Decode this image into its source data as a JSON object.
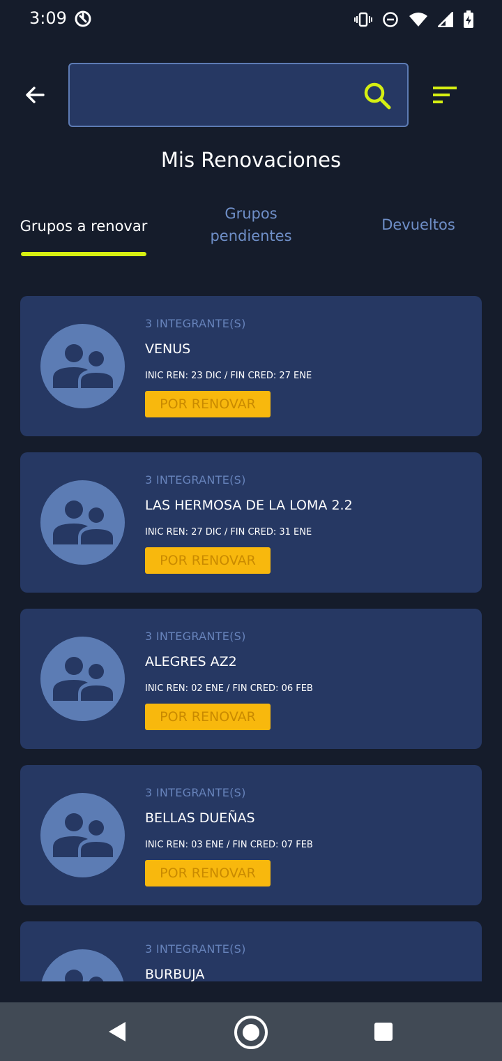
{
  "status_bar": {
    "time": "3:09"
  },
  "search": {
    "value": "",
    "placeholder": ""
  },
  "header": {
    "title": "Mis Renovaciones"
  },
  "tabs": [
    {
      "label": "Grupos a renovar"
    },
    {
      "label": "Grupos\npendientes"
    },
    {
      "label": "Devueltos"
    }
  ],
  "groups": [
    {
      "members": "3 INTEGRANTE(S)",
      "name": "VENUS",
      "dates": "INIC REN: 23 DIC / FIN CRED: 27 ENE",
      "status": "POR RENOVAR"
    },
    {
      "members": "3 INTEGRANTE(S)",
      "name": "LAS HERMOSA DE LA LOMA 2.2",
      "dates": "INIC REN: 27 DIC / FIN CRED: 31 ENE",
      "status": "POR RENOVAR"
    },
    {
      "members": "3 INTEGRANTE(S)",
      "name": "ALEGRES AZ2",
      "dates": "INIC REN: 02 ENE / FIN CRED: 06 FEB",
      "status": "POR RENOVAR"
    },
    {
      "members": "3 INTEGRANTE(S)",
      "name": "BELLAS DUEÑAS",
      "dates": "INIC REN: 03 ENE / FIN CRED: 07 FEB",
      "status": "POR RENOVAR"
    },
    {
      "members": "3 INTEGRANTE(S)",
      "name": "BURBUJA",
      "dates": "",
      "status": ""
    }
  ],
  "colors": {
    "background": "#151c2b",
    "card": "#263863",
    "accent": "#d6ef12",
    "badge": "#f8b80d",
    "avatar": "#5c7cb4"
  }
}
